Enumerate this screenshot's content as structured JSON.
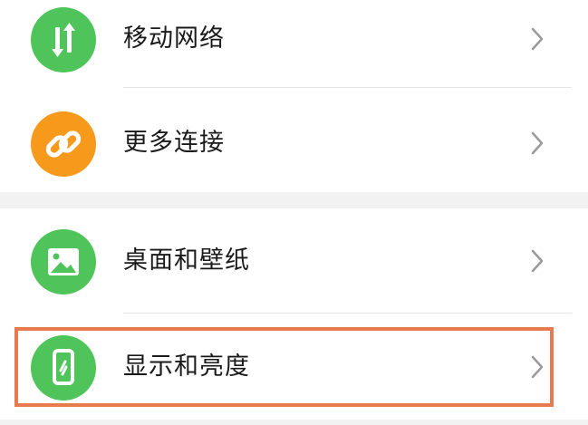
{
  "settings": {
    "items": [
      {
        "label": "移动网络",
        "icon": "mobile-data-icon",
        "icon_color": "#4fc45a"
      },
      {
        "label": "更多连接",
        "icon": "link-icon",
        "icon_color": "#f79a1b"
      },
      {
        "label": "桌面和壁纸",
        "icon": "wallpaper-icon",
        "icon_color": "#4fc45a"
      },
      {
        "label": "显示和亮度",
        "icon": "display-brightness-icon",
        "icon_color": "#4fc45a"
      }
    ]
  },
  "highlight": {
    "color": "#e77b4f",
    "target": "显示和亮度"
  }
}
